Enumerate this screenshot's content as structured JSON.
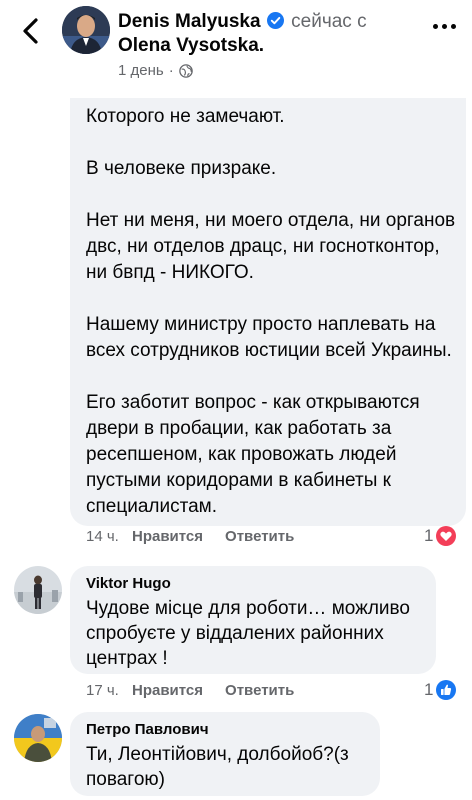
{
  "header": {
    "author": "Denis Malyuska",
    "verb": "сейчас с",
    "target": "Olena Vysotska.",
    "time": "1 день",
    "dot": "·"
  },
  "main_comment": {
    "paragraphs": [
      "Которого не замечают.",
      "В человеке призраке.",
      "Нет ни меня, ни моего отдела, ни органов двс, ни отделов драцс, ни госнотконтор, ни бвпд - НИКОГО.",
      "Нашему министру просто наплевать на всех сотрудников юстиции всей Украины.",
      "Его заботит вопрос - как открываются двери в пробации, как работать за ресепшеном, как провожать людей пустыми коридорами в кабинеты к специалистам."
    ],
    "time": "14 ч.",
    "like_label": "Нравится",
    "reply_label": "Ответить",
    "reaction_count": "1",
    "reaction": "love"
  },
  "comments": [
    {
      "author": "Viktor Hugo",
      "text": "Чудове місце для роботи… можливо спробуєте у віддалених районних центрах !",
      "time": "17 ч.",
      "like_label": "Нравится",
      "reply_label": "Ответить",
      "reaction_count": "1",
      "reaction": "like"
    },
    {
      "author": "Петро Павлович",
      "text": "Ти, Леонтійович, долбойоб?(з повагою)"
    }
  ],
  "colors": {
    "bubble": "#f0f2f5",
    "meta": "#65676b",
    "verified": "#1877f2",
    "love": "#f33e58",
    "like": "#1877f2"
  },
  "icons": [
    "back-chevron-icon",
    "verified-icon",
    "globe-icon",
    "more-icon",
    "love-reaction-icon",
    "like-reaction-icon"
  ]
}
